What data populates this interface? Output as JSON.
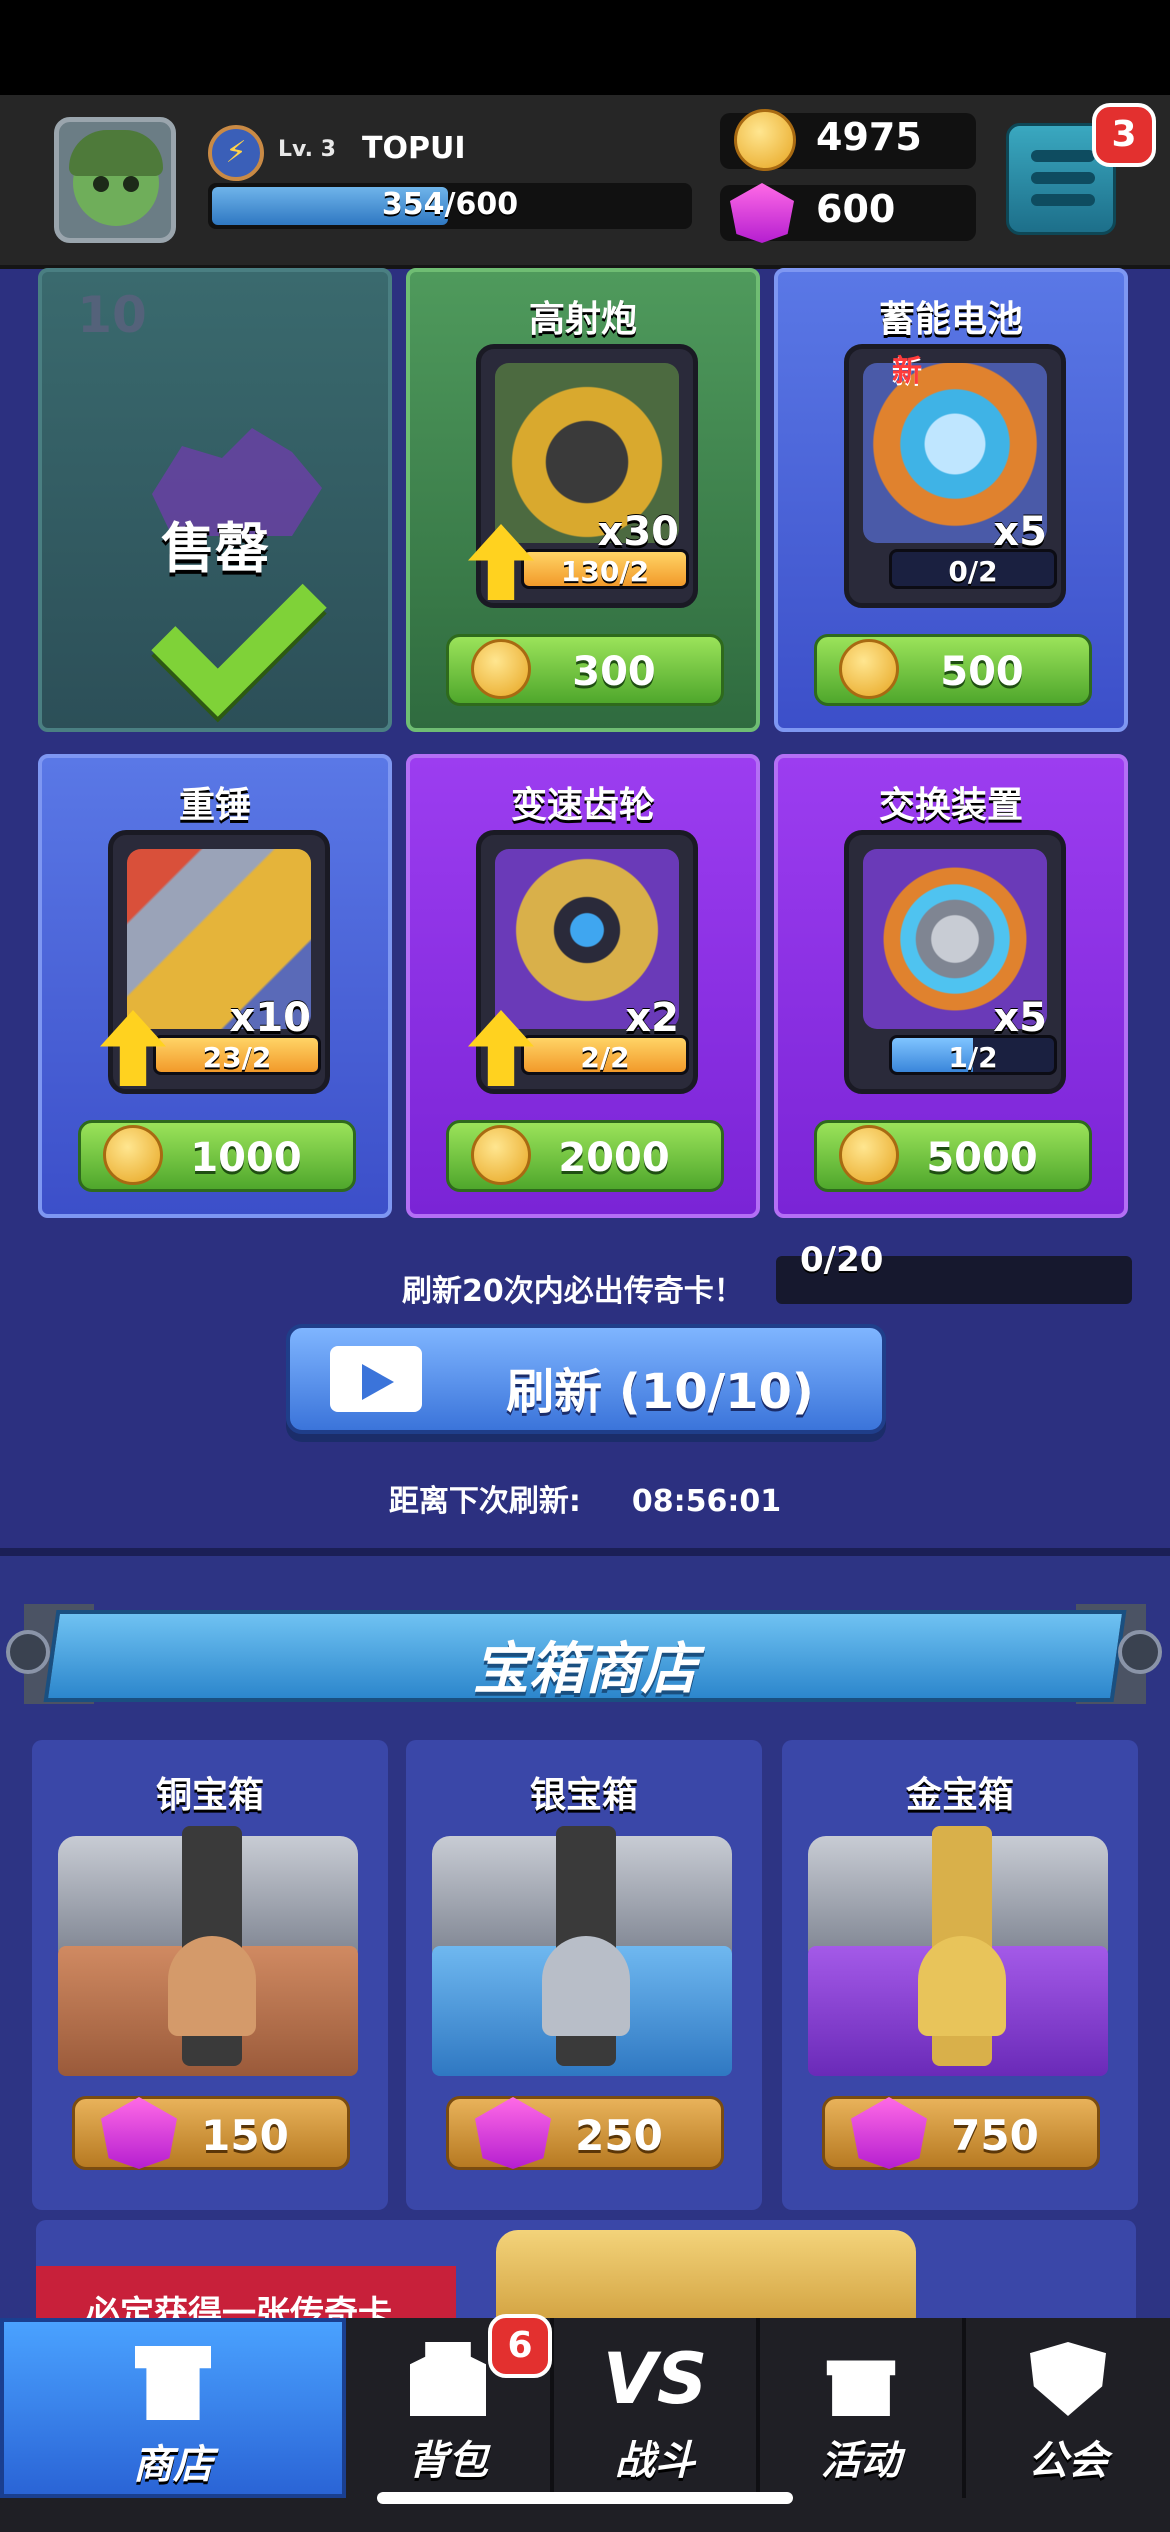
{
  "header": {
    "level": "Lv. 3",
    "player_name": "TOPUI",
    "xp_text": "354/600",
    "xp_fraction": 0.59,
    "coins": "4975",
    "gems": "600",
    "menu_badge": "3"
  },
  "shop_cards": [
    {
      "sold_count": "10",
      "sold_label": "售罄"
    },
    {
      "title": "高射炮",
      "qty": "x30",
      "progress": "130/2",
      "price": "300"
    },
    {
      "title": "蓄能电池",
      "new_tag": "新",
      "qty": "x5",
      "progress": "0/2",
      "price": "500"
    },
    {
      "title": "重锤",
      "qty": "x10",
      "progress": "23/2",
      "price": "1000"
    },
    {
      "title": "变速齿轮",
      "qty": "x2",
      "progress": "2/2",
      "price": "2000"
    },
    {
      "title": "交换装置",
      "qty": "x5",
      "progress": "1/2",
      "price": "5000"
    }
  ],
  "refresh": {
    "hint": "刷新20次内必出传奇卡！",
    "counter": "0/20",
    "button_label": "刷新 (10/10)",
    "countdown_label": "距离下次刷新:",
    "countdown_time": "08:56:01"
  },
  "chest_shop": {
    "title": "宝箱商店",
    "chests": [
      {
        "name": "铜宝箱",
        "price": "150"
      },
      {
        "name": "银宝箱",
        "price": "250"
      },
      {
        "name": "金宝箱",
        "price": "750"
      }
    ],
    "promo_text": "必定获得一张传奇卡"
  },
  "nav": {
    "items": [
      {
        "label": "商店",
        "icon": "shop-icon",
        "active": true
      },
      {
        "label": "背包",
        "icon": "backpack-icon",
        "badge": "6"
      },
      {
        "label": "战斗",
        "icon": "vs-icon"
      },
      {
        "label": "活动",
        "icon": "gift-icon"
      },
      {
        "label": "公会",
        "icon": "guild-shield-icon"
      }
    ]
  },
  "colors": {
    "background": "#2c3080",
    "price_button": "#6cc23a",
    "accent_blue": "#3b74da",
    "badge_red": "#e3302f"
  }
}
